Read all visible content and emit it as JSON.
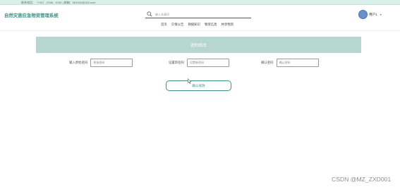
{
  "topbar": {
    "contact_text": "联系电话：（+01）-2345 - 6789 | 邮箱：001002@163.com"
  },
  "header": {
    "site_title": "自然灾害应急物资管理系统",
    "search_placeholder": "输入关键词",
    "search_icon": "search-icon",
    "nav": [
      {
        "label": "首页"
      },
      {
        "label": "灾情公告"
      },
      {
        "label": "救援知识"
      },
      {
        "label": "物资信息"
      },
      {
        "label": "共享物资"
      }
    ],
    "user": {
      "avatar_text": "•",
      "name": "用户1",
      "chevron": "▾"
    }
  },
  "banner": {
    "title": "密码修改"
  },
  "form": {
    "fields": [
      {
        "label": "输入原始密码",
        "placeholder": "原始密码"
      },
      {
        "label": "设置新密码",
        "placeholder": "设置新密码"
      },
      {
        "label": "确认密码",
        "placeholder": "确认密码"
      }
    ],
    "submit_label": "确认修改"
  },
  "watermark": "CSDN @MZ_ZXD001",
  "colors": {
    "accent": "#3d8f86",
    "banner_bg": "#b8d6d0",
    "topbar_bg": "#d9f0ea"
  }
}
